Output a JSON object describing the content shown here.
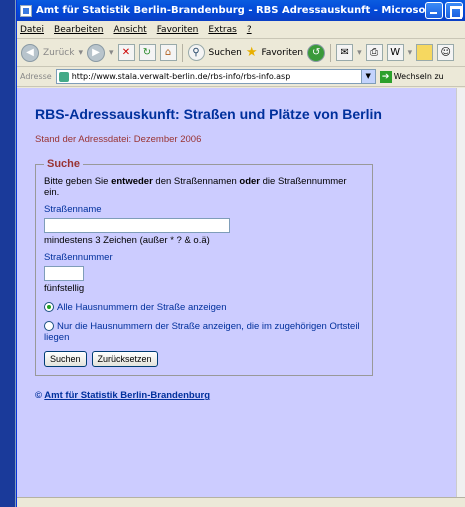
{
  "window": {
    "title": "Amt für Statistik Berlin-Brandenburg - RBS Adressauskunft - Microsoft Internet Explorer"
  },
  "menu": [
    "Datei",
    "Bearbeiten",
    "Ansicht",
    "Favoriten",
    "Extras",
    "?"
  ],
  "toolbar": {
    "back": "Zurück",
    "search": "Suchen",
    "favorites": "Favoriten"
  },
  "address": {
    "label": "Adresse",
    "url": "http://www.stala.verwalt-berlin.de/rbs-info/rbs-info.asp",
    "go": "Wechseln zu"
  },
  "page": {
    "heading": "RBS-Adressauskunft: Straßen und Plätze von Berlin",
    "stand": "Stand der Adressdatei: Dezember 2006",
    "legend": "Suche",
    "desc_pre": "Bitte geben Sie ",
    "desc_b1": "entweder",
    "desc_mid": " den Straßennamen ",
    "desc_b2": "oder",
    "desc_post": " die Straßennummer ein.",
    "street_name_label": "Straßenname",
    "street_name_value": "",
    "street_name_hint": "mindestens 3 Zeichen (außer * ? & o.ä)",
    "street_number_label": "Straßennummer",
    "street_number_value": "",
    "street_number_hint": "fünfstellig",
    "radio1": "Alle Hausnummern der Straße anzeigen",
    "radio2": "Nur die Hausnummern der Straße anzeigen, die im zugehörigen Ortsteil liegen",
    "radio_selected": 1,
    "search_button": "Suchen",
    "reset_button": "Zurücksetzen",
    "footer_copy": "©",
    "footer_link": "Amt für Statistik Berlin-Brandenburg"
  }
}
